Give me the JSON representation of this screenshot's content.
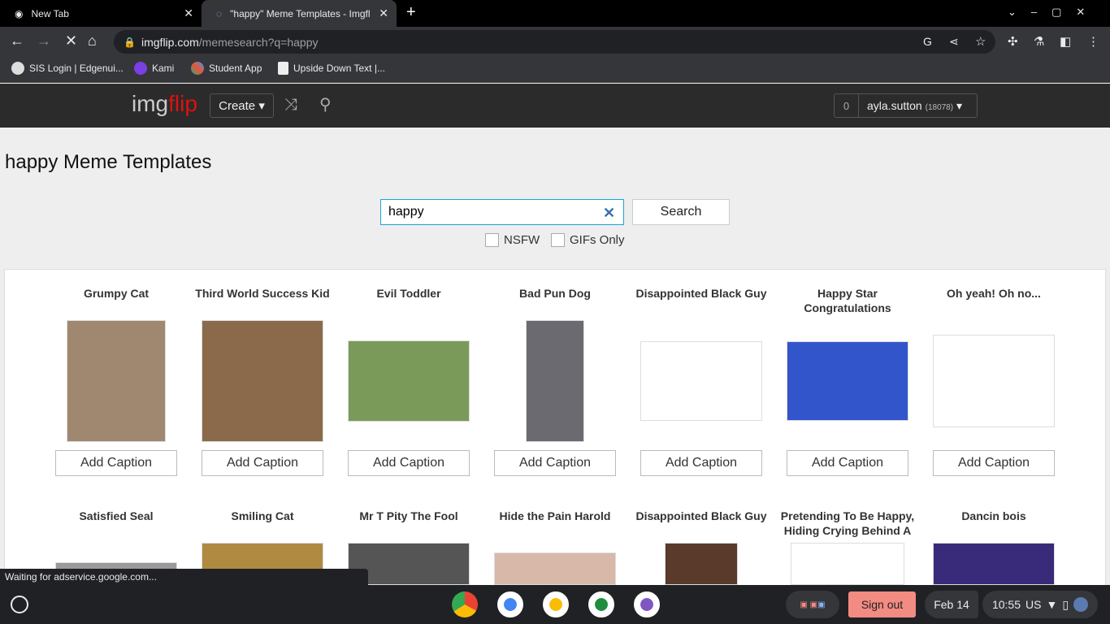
{
  "browser": {
    "tabs": [
      {
        "label": "New Tab"
      },
      {
        "label": "\"happy\" Meme Templates - Imgfl"
      }
    ],
    "url_host": "imgflip.com",
    "url_path": "/memesearch?q=happy",
    "bookmarks": [
      {
        "label": "SIS Login | Edgenui..."
      },
      {
        "label": "Kami"
      },
      {
        "label": "Student App"
      },
      {
        "label": "Upside Down Text |..."
      }
    ]
  },
  "site": {
    "logo": "imgflip",
    "create_label": "Create",
    "notif_count": "0",
    "username": "ayla.sutton",
    "points": "(18078)"
  },
  "page": {
    "title": "happy Meme Templates",
    "search_value": "happy",
    "search_button": "Search",
    "nsfw_label": "NSFW",
    "gifs_label": "GIFs Only",
    "add_caption": "Add Caption"
  },
  "memes_row1": [
    {
      "title": "Grumpy Cat",
      "color": "#a08870"
    },
    {
      "title": "Third World Success Kid",
      "color": "#8a6a4a"
    },
    {
      "title": "Evil Toddler",
      "color": "#7a9a5a"
    },
    {
      "title": "Bad Pun Dog",
      "color": "#6a6a70"
    },
    {
      "title": "Disappointed Black Guy",
      "color": "#ffffff"
    },
    {
      "title": "Happy Star Congratulations",
      "color": "#3355cc"
    },
    {
      "title": "Oh yeah! Oh no...",
      "color": "#ffffff"
    }
  ],
  "memes_row2": [
    {
      "title": "Satisfied Seal",
      "color": "#9a9a9a"
    },
    {
      "title": "Smiling Cat",
      "color": "#b08a40"
    },
    {
      "title": "Mr T Pity The Fool",
      "color": "#555555"
    },
    {
      "title": "Hide the Pain Harold",
      "color": "#d8b8a8"
    },
    {
      "title": "Disappointed Black Guy",
      "color": "#5a3a2a"
    },
    {
      "title": "Pretending To Be Happy, Hiding Crying Behind A Mask",
      "color": "#ffffff"
    },
    {
      "title": "Dancin bois",
      "color": "#3a2a7a"
    }
  ],
  "status": "Waiting for adservice.google.com...",
  "shelf": {
    "signout": "Sign out",
    "date": "Feb 14",
    "time": "10:55",
    "locale": "US"
  }
}
